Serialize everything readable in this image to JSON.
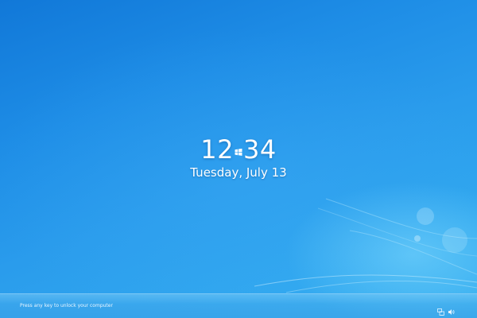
{
  "lock_screen": {
    "time_hours": "12",
    "time_minutes": "34",
    "date": "Tuesday, July 13",
    "unlock_hint": "Press any key to unlock your computer"
  },
  "tray": {
    "icons": [
      "network-icon",
      "volume-icon"
    ]
  },
  "colors": {
    "background_top": "#1178d8",
    "background_bottom": "#38b0f0",
    "text": "#ffffff"
  }
}
